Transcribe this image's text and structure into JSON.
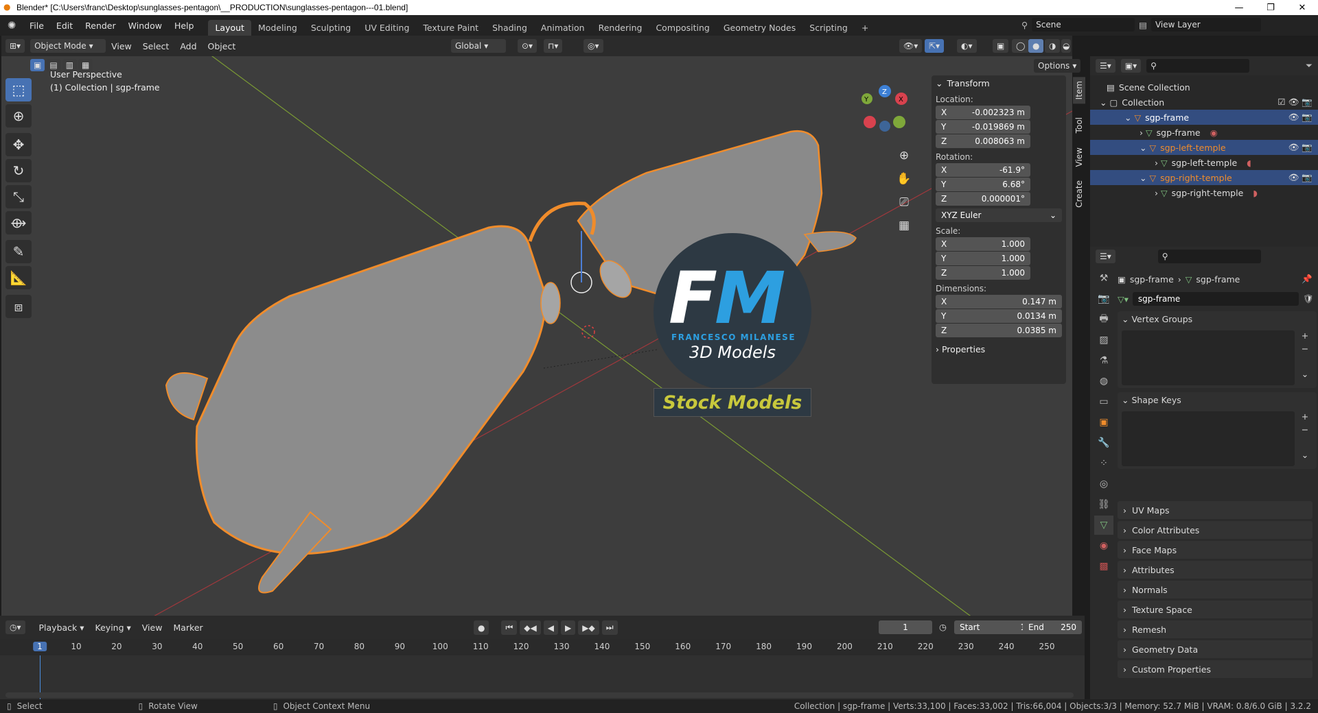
{
  "window": {
    "title": "Blender* [C:\\Users\\franc\\Desktop\\sunglasses-pentagon\\__PRODUCTION\\sunglasses-pentagon---01.blend]"
  },
  "menu": [
    "File",
    "Edit",
    "Render",
    "Window",
    "Help"
  ],
  "workspaces": [
    "Layout",
    "Modeling",
    "Sculpting",
    "UV Editing",
    "Texture Paint",
    "Shading",
    "Animation",
    "Rendering",
    "Compositing",
    "Geometry Nodes",
    "Scripting"
  ],
  "scene": {
    "name": "Scene",
    "view_layer": "View Layer"
  },
  "viewport": {
    "mode": "Object Mode",
    "menus": [
      "View",
      "Select",
      "Add",
      "Object"
    ],
    "orientation": "Global",
    "options": "Options",
    "perspective": "User Perspective",
    "collection_info": "(1) Collection | sgp-frame"
  },
  "watermark": {
    "letters": "FM",
    "name": "FRANCESCO MILANESE",
    "sub": "3D Models",
    "banner": "Stock Models"
  },
  "npanel": {
    "tabs": [
      "Item",
      "Tool",
      "View",
      "Create"
    ],
    "transform": "Transform",
    "location_label": "Location:",
    "location": {
      "x": "-0.002323 m",
      "y": "-0.019869 m",
      "z": "0.008063 m"
    },
    "rotation_label": "Rotation:",
    "rotation": {
      "x": "-61.9°",
      "y": "6.68°",
      "z": "0.000001°"
    },
    "rotation_mode": "XYZ Euler",
    "scale_label": "Scale:",
    "scale": {
      "x": "1.000",
      "y": "1.000",
      "z": "1.000"
    },
    "dimensions_label": "Dimensions:",
    "dimensions": {
      "x": "0.147 m",
      "y": "0.0134 m",
      "z": "0.0385 m"
    },
    "properties": "Properties"
  },
  "outliner": {
    "scene_collection": "Scene Collection",
    "collection": "Collection",
    "items": [
      {
        "label": "sgp-frame"
      },
      {
        "label": "sgp-frame"
      },
      {
        "label": "sgp-left-temple"
      },
      {
        "label": "sgp-left-temple"
      },
      {
        "label": "sgp-right-temple"
      },
      {
        "label": "sgp-right-temple"
      }
    ]
  },
  "properties": {
    "breadcrumb_obj": "sgp-frame",
    "breadcrumb_mesh": "sgp-frame",
    "mesh_name": "sgp-frame",
    "vertex_groups": "Vertex Groups",
    "shape_keys": "Shape Keys",
    "sections": [
      "UV Maps",
      "Color Attributes",
      "Face Maps",
      "Attributes",
      "Normals",
      "Texture Space",
      "Remesh",
      "Geometry Data",
      "Custom Properties"
    ]
  },
  "timeline": {
    "menus": [
      "Playback",
      "Keying",
      "View",
      "Marker"
    ],
    "current_frame": "1",
    "start_label": "Start",
    "start": "1",
    "end_label": "End",
    "end": "250",
    "ticks": [
      "1",
      "10",
      "20",
      "30",
      "40",
      "50",
      "60",
      "70",
      "80",
      "90",
      "100",
      "110",
      "120",
      "130",
      "140",
      "150",
      "160",
      "170",
      "180",
      "190",
      "200",
      "210",
      "220",
      "230",
      "240",
      "250"
    ]
  },
  "status": {
    "select": "Select",
    "rotate": "Rotate View",
    "context": "Object Context Menu",
    "stats": "Collection | sgp-frame | Verts:33,100 | Faces:33,002 | Tris:66,004 | Objects:3/3 | Memory: 52.7 MiB | VRAM: 0.8/6.0 GiB | 3.2.2"
  },
  "colors": {
    "accent": "#4772b3",
    "selection": "#f08c2b",
    "watermark_text": "#c8c83c"
  }
}
